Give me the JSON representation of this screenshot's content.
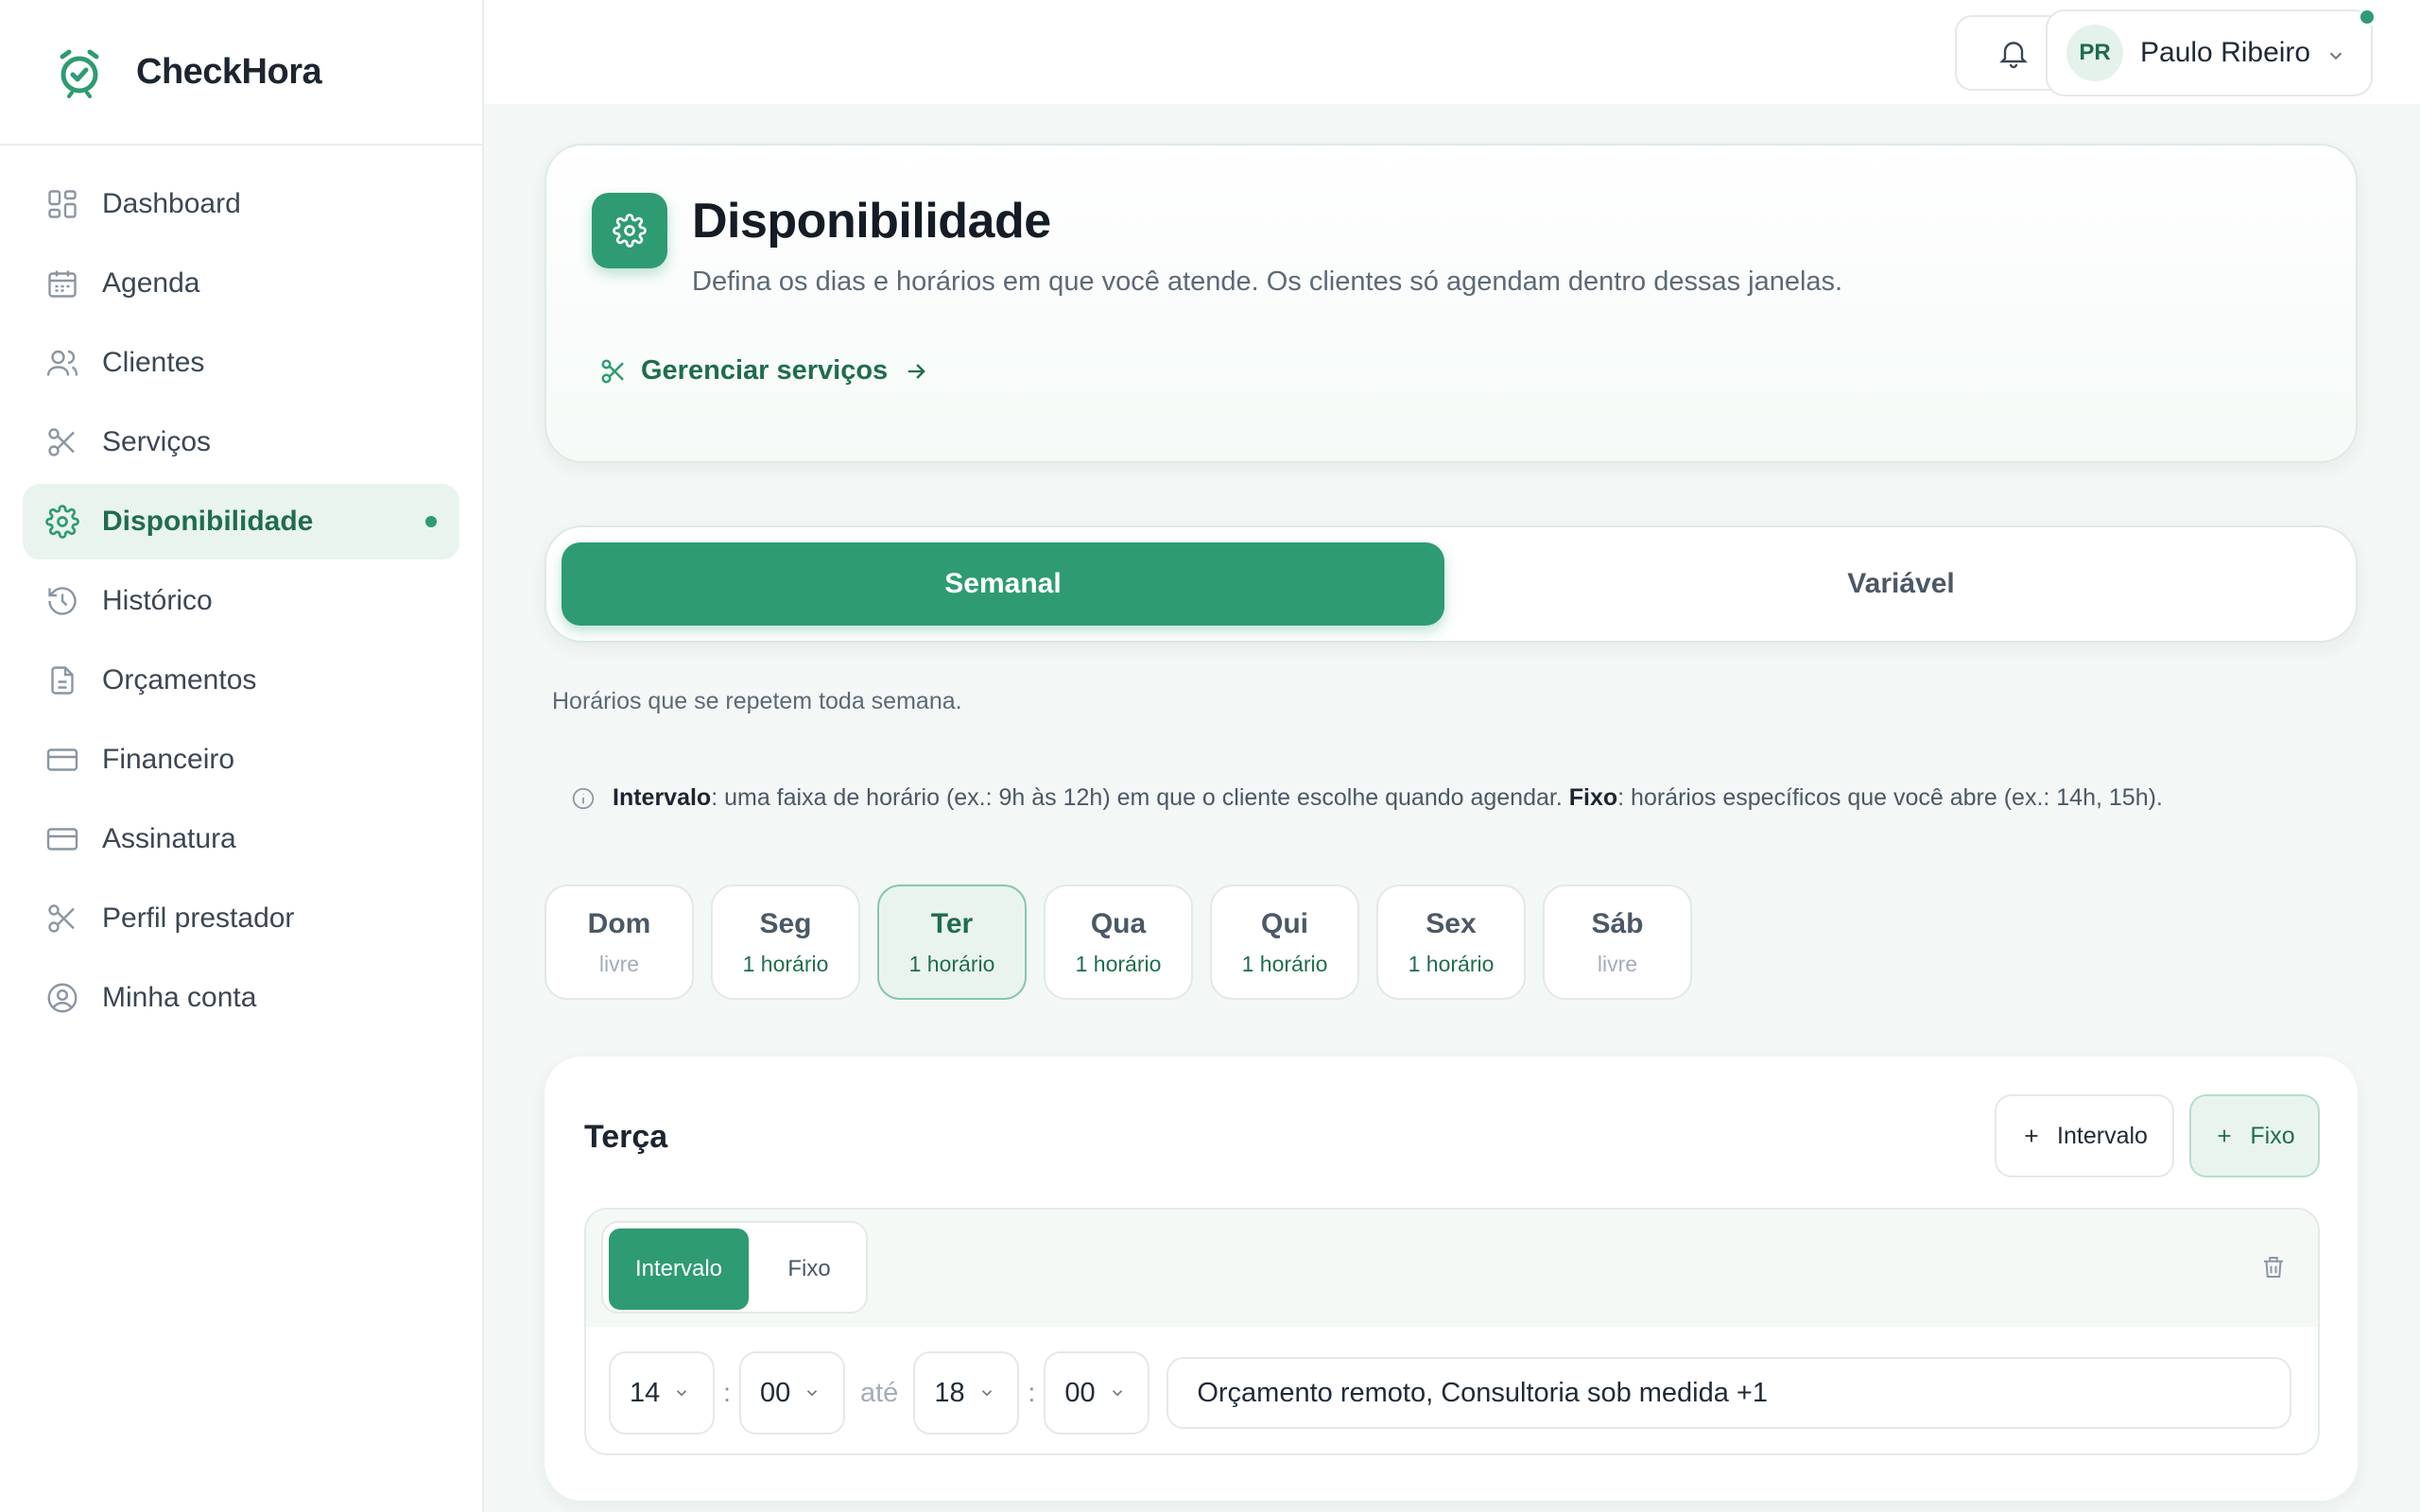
{
  "brand": {
    "name": "CheckHora",
    "accent": "#2e9b73"
  },
  "sidebar": {
    "items": [
      {
        "label": "Dashboard",
        "icon": "grid-icon"
      },
      {
        "label": "Agenda",
        "icon": "calendar-icon"
      },
      {
        "label": "Clientes",
        "icon": "users-icon"
      },
      {
        "label": "Serviços",
        "icon": "scissors-icon"
      },
      {
        "label": "Disponibilidade",
        "icon": "gear-icon",
        "active": true
      },
      {
        "label": "Histórico",
        "icon": "history-icon"
      },
      {
        "label": "Orçamentos",
        "icon": "document-icon"
      },
      {
        "label": "Financeiro",
        "icon": "credit-card-icon"
      },
      {
        "label": "Assinatura",
        "icon": "credit-card-icon"
      },
      {
        "label": "Perfil prestador",
        "icon": "scissors-icon"
      },
      {
        "label": "Minha conta",
        "icon": "user-circle-icon"
      }
    ]
  },
  "topbar": {
    "user": {
      "initials": "PR",
      "name": "Paulo Ribeiro"
    }
  },
  "header": {
    "title": "Disponibilidade",
    "description": "Defina os dias e horários em que você atende. Os clientes só agendam dentro dessas janelas.",
    "manage_link": "Gerenciar serviços"
  },
  "segment": {
    "weekly": "Semanal",
    "variable": "Variável"
  },
  "note": "Horários que se repetem toda semana.",
  "info": {
    "intervalo_label": "Intervalo",
    "intervalo_text": ": uma faixa de horário (ex.: 9h às 12h) em que o cliente escolhe quando agendar. ",
    "fixo_label": "Fixo",
    "fixo_text": ": horários específicos que você abre (ex.: 14h, 15h)."
  },
  "days": [
    {
      "name": "Dom",
      "status": "livre"
    },
    {
      "name": "Seg",
      "status": "1 horário"
    },
    {
      "name": "Ter",
      "status": "1 horário",
      "selected": true
    },
    {
      "name": "Qua",
      "status": "1 horário"
    },
    {
      "name": "Qui",
      "status": "1 horário"
    },
    {
      "name": "Sex",
      "status": "1 horário"
    },
    {
      "name": "Sáb",
      "status": "livre"
    }
  ],
  "detail": {
    "title": "Terça",
    "add_intervalo": "Intervalo",
    "add_fixo": "Fixo",
    "slot": {
      "mode_intervalo": "Intervalo",
      "mode_fixo": "Fixo",
      "start_hour": "14",
      "start_min": "00",
      "separator": "até",
      "end_hour": "18",
      "end_min": "00",
      "services": "Orçamento remoto, Consultoria sob medida +1"
    }
  }
}
